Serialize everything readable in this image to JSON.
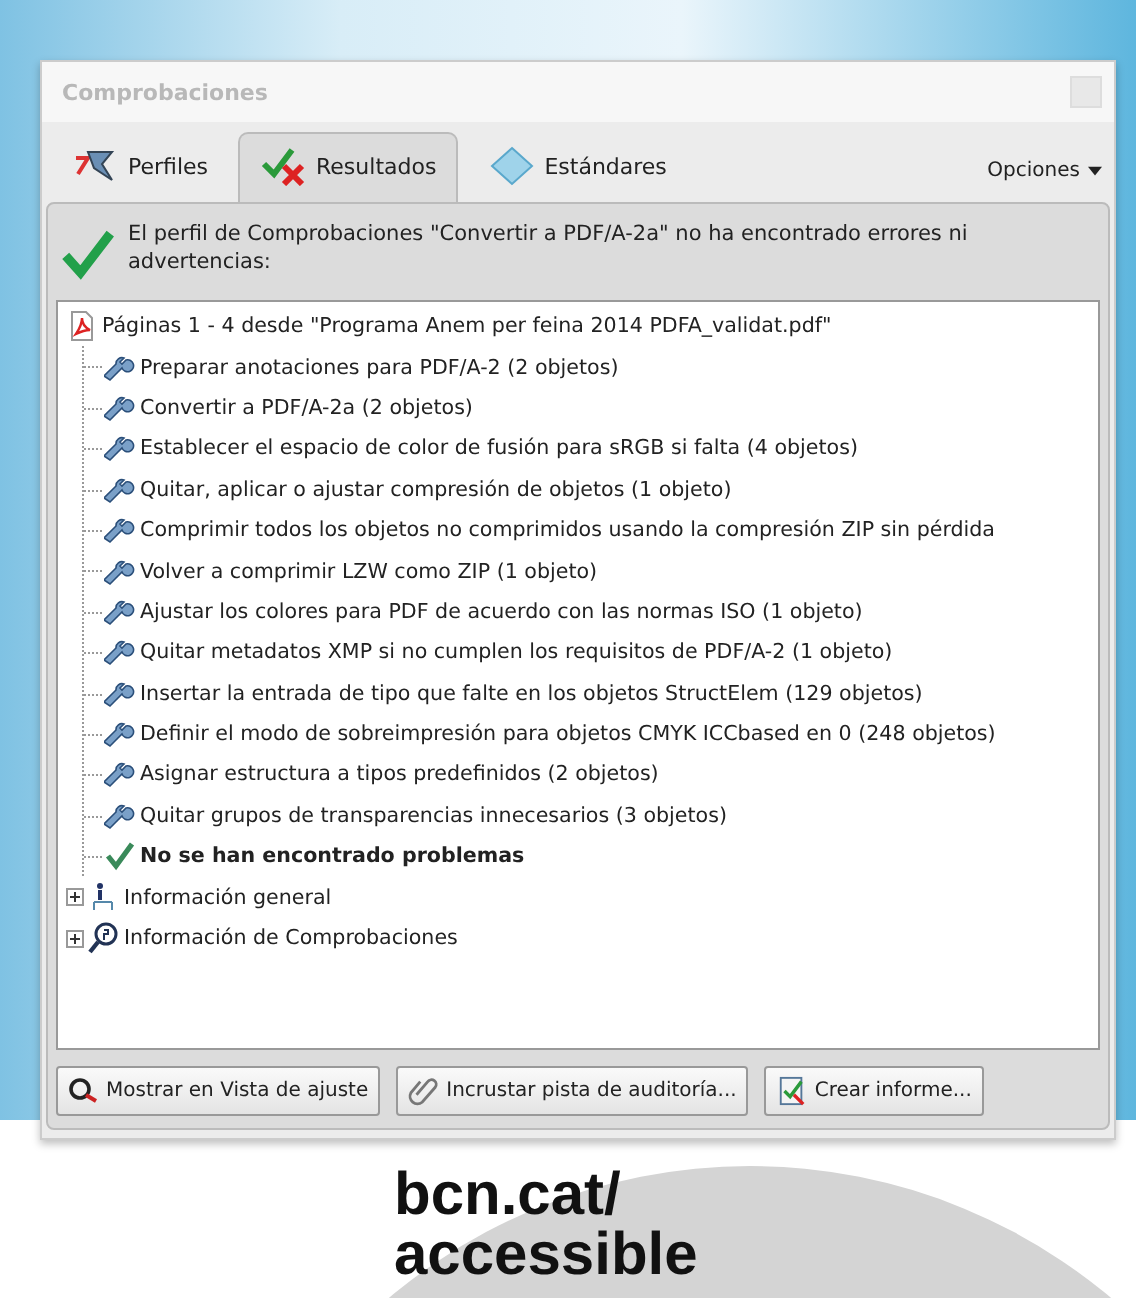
{
  "window": {
    "title": "Comprobaciones"
  },
  "tabs": [
    {
      "label": "Perfiles",
      "kind": "profiles",
      "selected": false
    },
    {
      "label": "Resultados",
      "kind": "results",
      "selected": true
    },
    {
      "label": "Estándares",
      "kind": "standards",
      "selected": false
    }
  ],
  "options_menu": {
    "label": "Opciones"
  },
  "message": "El perfil de Comprobaciones \"Convertir a PDF/A-2a\" no ha encontrado errores ni advertencias:",
  "tree": [
    {
      "label": "Páginas 1 - 4 desde \"Programa Anem per feina 2014 PDFA_validat.pdf\"",
      "kind": "file",
      "children": [
        {
          "label": "Preparar anotaciones para PDF/A-2 (2 objetos)",
          "kind": "fix"
        },
        {
          "label": "Convertir a PDF/A-2a (2 objetos)",
          "kind": "fix"
        },
        {
          "label": "Establecer el espacio de color de fusión para sRGB si falta (4 objetos)",
          "kind": "fix"
        },
        {
          "label": "Quitar, aplicar o ajustar compresión de objetos (1 objeto)",
          "kind": "fix"
        },
        {
          "label": "Comprimir todos los objetos no comprimidos usando la compresión ZIP sin pérdida",
          "kind": "fix"
        },
        {
          "label": "Volver a comprimir LZW como ZIP (1 objeto)",
          "kind": "fix"
        },
        {
          "label": "Ajustar los colores para PDF de acuerdo con las normas ISO (1 objeto)",
          "kind": "fix"
        },
        {
          "label": "Quitar metadatos XMP si no cumplen los requisitos de PDF/A-2 (1 objeto)",
          "kind": "fix"
        },
        {
          "label": "Insertar la entrada de tipo que falte en los objetos StructElem (129 objetos)",
          "kind": "fix"
        },
        {
          "label": "Definir el modo de sobreimpresión para objetos CMYK ICCbased en 0 (248 objetos)",
          "kind": "fix"
        },
        {
          "label": "Asignar estructura a tipos predefinidos (2 objetos)",
          "kind": "fix"
        },
        {
          "label": "Quitar grupos de transparencias innecesarios (3 objetos)",
          "kind": "fix"
        },
        {
          "label": "No se han encontrado problemas",
          "kind": "ok"
        }
      ]
    },
    {
      "label": "Información general",
      "kind": "info",
      "expanded": false
    },
    {
      "label": "Información de Comprobaciones",
      "kind": "checks",
      "expanded": false
    }
  ],
  "buttons": [
    {
      "label": "Mostrar en Vista de ajuste",
      "kind": "show"
    },
    {
      "label": "Incrustar pista de auditoría...",
      "kind": "embed"
    },
    {
      "label": "Crear informe...",
      "kind": "report"
    }
  ],
  "footer": {
    "url_line_1": "bcn.cat/",
    "url_line_2": "accessible"
  }
}
